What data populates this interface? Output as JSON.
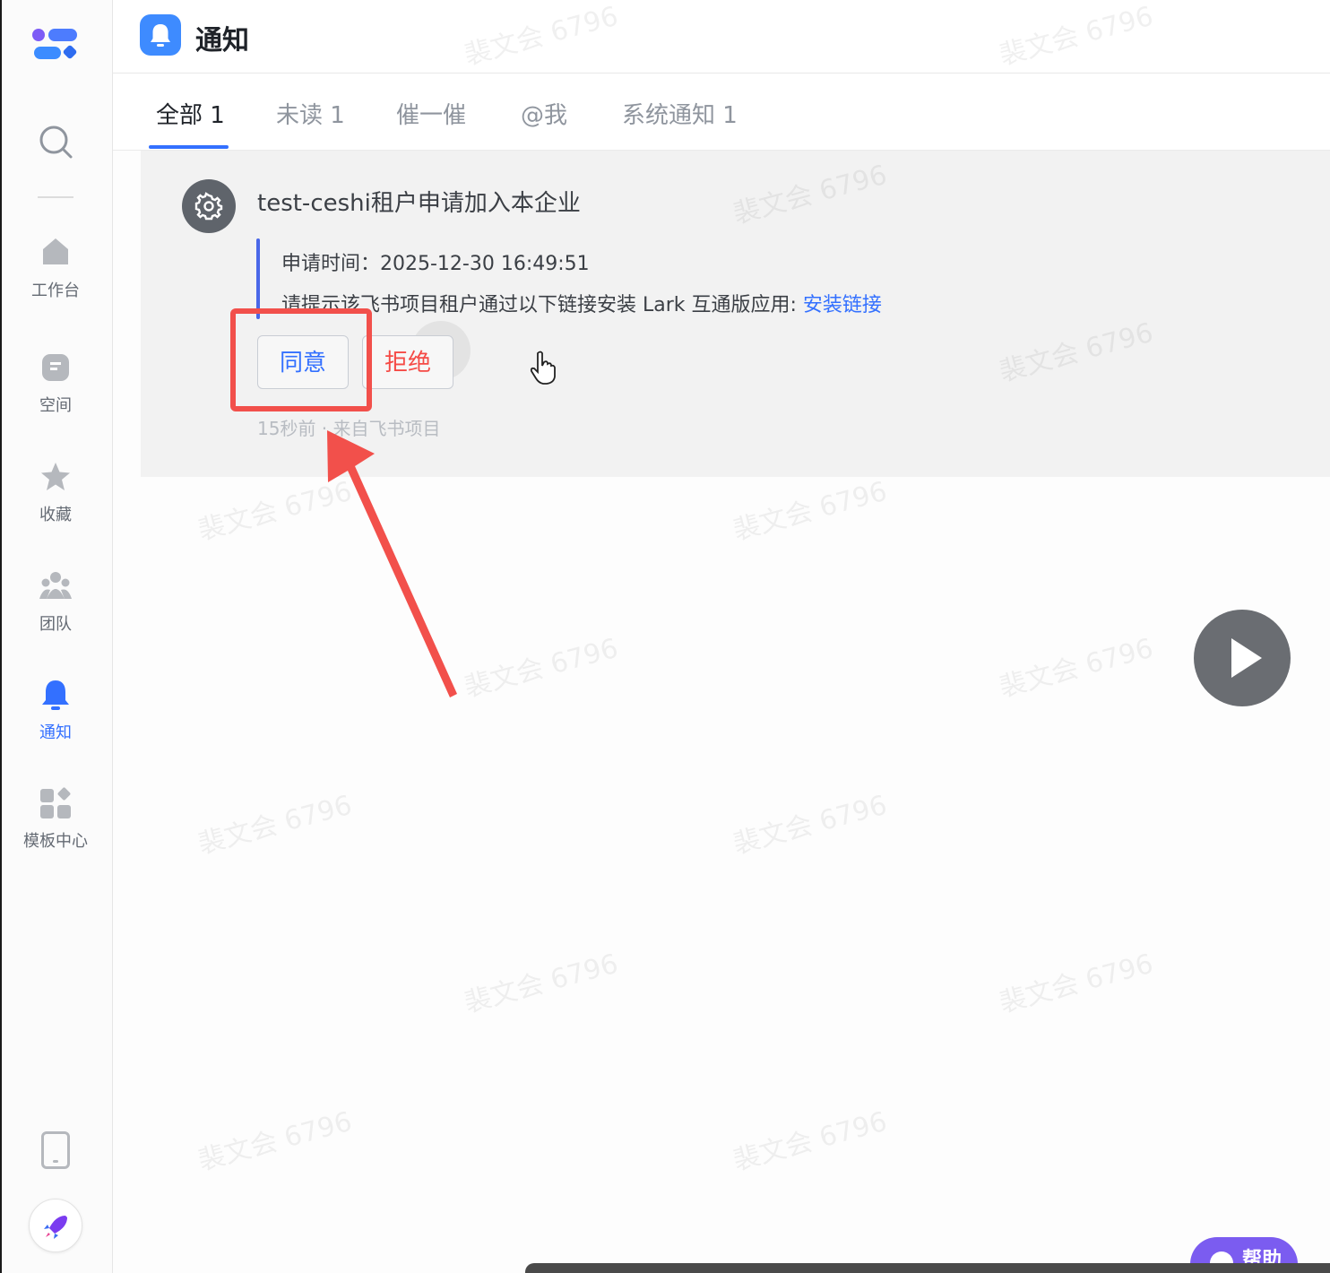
{
  "page": {
    "title": "通知"
  },
  "sidebar": {
    "items": [
      {
        "key": "workbench",
        "label": "工作台",
        "icon": "home-icon"
      },
      {
        "key": "space",
        "label": "空间",
        "icon": "doc-icon"
      },
      {
        "key": "favorites",
        "label": "收藏",
        "icon": "star-icon"
      },
      {
        "key": "team",
        "label": "团队",
        "icon": "people-icon"
      },
      {
        "key": "notifications",
        "label": "通知",
        "icon": "bell-icon",
        "active": true
      },
      {
        "key": "templates",
        "label": "模板中心",
        "icon": "grid-icon"
      }
    ]
  },
  "tabs": [
    {
      "label": "全部 1",
      "active": true
    },
    {
      "label": "未读 1"
    },
    {
      "label": "催一催"
    },
    {
      "label": "@我"
    },
    {
      "label": "系统通知 1"
    }
  ],
  "notification": {
    "title": "test-ceshi租户申请加入本企业",
    "apply_time": "申请时间：2025-12-30 16:49:51",
    "message": "请提示该飞书项目租户通过以下链接安装 Lark 互通版应用: ",
    "link_label": "安装链接",
    "agree_label": "同意",
    "reject_label": "拒绝",
    "footer": "15秒前 · 来自飞书项目"
  },
  "help": {
    "label": "帮助"
  },
  "watermark": "裴文会 6796",
  "colors": {
    "accent": "#3370ff",
    "reject": "#f54a45",
    "annotation": "#f2504b"
  }
}
